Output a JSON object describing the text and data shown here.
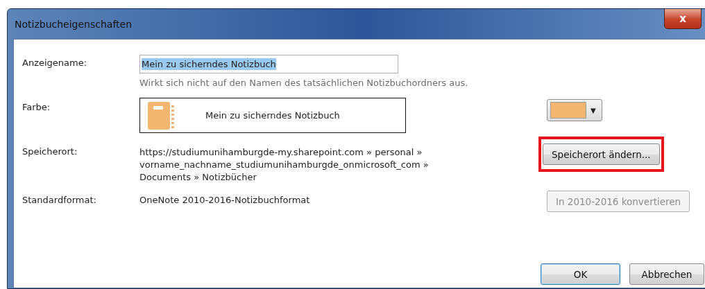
{
  "window": {
    "title": "Notizbucheigenschaften",
    "close_label": "x"
  },
  "display_name": {
    "label": "Anzeigename:",
    "value": "Mein zu sicherndes Notizbuch",
    "selected": true,
    "hint": "Wirkt sich nicht auf den Namen des tatsächlichen Notizbuchordners aus."
  },
  "color": {
    "label": "Farbe:",
    "preview_name": "Mein zu sicherndes Notizbuch",
    "color": "#f3b671",
    "dropdown_caret": "▼"
  },
  "location": {
    "label": "Speicherort:",
    "path_lines": [
      "https://studiumunihamburgde-my.sharepoint.com » personal »",
      "vorname_nachname_studiumunihamburgde_onmicrosoft_com »",
      "Documents » Notizbücher"
    ],
    "button": {
      "label": "Speicherort ändern...",
      "disabled": false,
      "highlighted": true
    }
  },
  "format": {
    "label": "Standardformat:",
    "value": "OneNote 2010-2016-Notizbuchformat",
    "button": {
      "label": "In 2010-2016 konvertieren",
      "disabled": true
    }
  },
  "buttons": [
    {
      "label": "OK",
      "default": true
    },
    {
      "label": "Abbrechen",
      "default": false
    }
  ]
}
